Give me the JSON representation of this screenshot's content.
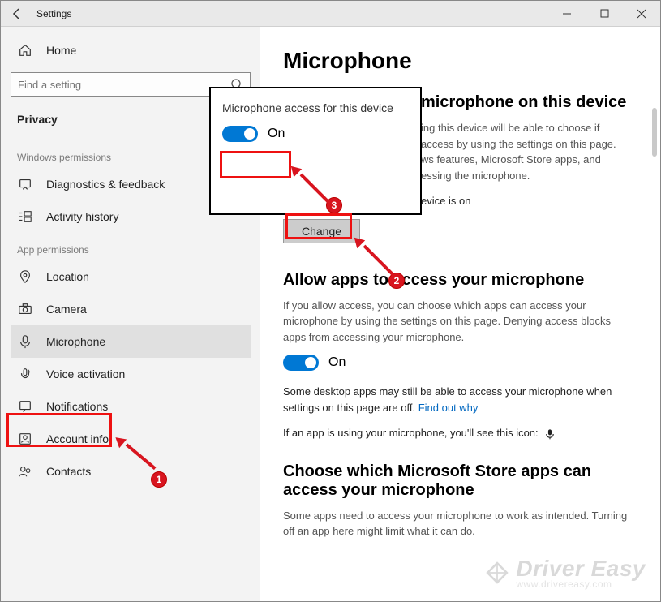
{
  "titlebar": {
    "title": "Settings"
  },
  "sidebar": {
    "home": "Home",
    "search_placeholder": "Find a setting",
    "section": "Privacy",
    "group1": "Windows permissions",
    "group2": "App permissions",
    "items_win": [
      {
        "label": "Diagnostics & feedback"
      },
      {
        "label": "Activity history"
      }
    ],
    "items_app": [
      {
        "label": "Location"
      },
      {
        "label": "Camera"
      },
      {
        "label": "Microphone"
      },
      {
        "label": "Voice activation"
      },
      {
        "label": "Notifications"
      },
      {
        "label": "Account info"
      },
      {
        "label": "Contacts"
      }
    ]
  },
  "content": {
    "h1": "Microphone",
    "h2a": "microphone on this device",
    "p1a": "ing this device will be able to choose if",
    "p1b": "access by using the settings on this page.",
    "p1c": "ws features, Microsoft Store apps, and",
    "p1d": "essing the microphone.",
    "status_line": "evice is on",
    "change": "Change",
    "h2b": "Allow apps to access your microphone",
    "p2": "If you allow access, you can choose which apps can access your microphone by using the settings on this page. Denying access blocks apps from accessing your microphone.",
    "toggle_label": "On",
    "p3a": "Some desktop apps may still be able to access your microphone when settings on this page are off. ",
    "p3link": "Find out why",
    "p4": "If an app is using your microphone, you'll see this icon:",
    "h2c": "Choose which Microsoft Store apps can access your microphone",
    "p5": "Some apps need to access your microphone to work as intended. Turning off an app here might limit what it can do."
  },
  "popup": {
    "title": "Microphone access for this device",
    "toggle_label": "On"
  },
  "annotations": {
    "c1": "1",
    "c2": "2",
    "c3": "3"
  },
  "watermark": {
    "brand": "Driver Easy",
    "url": "www.drivereasy.com"
  }
}
